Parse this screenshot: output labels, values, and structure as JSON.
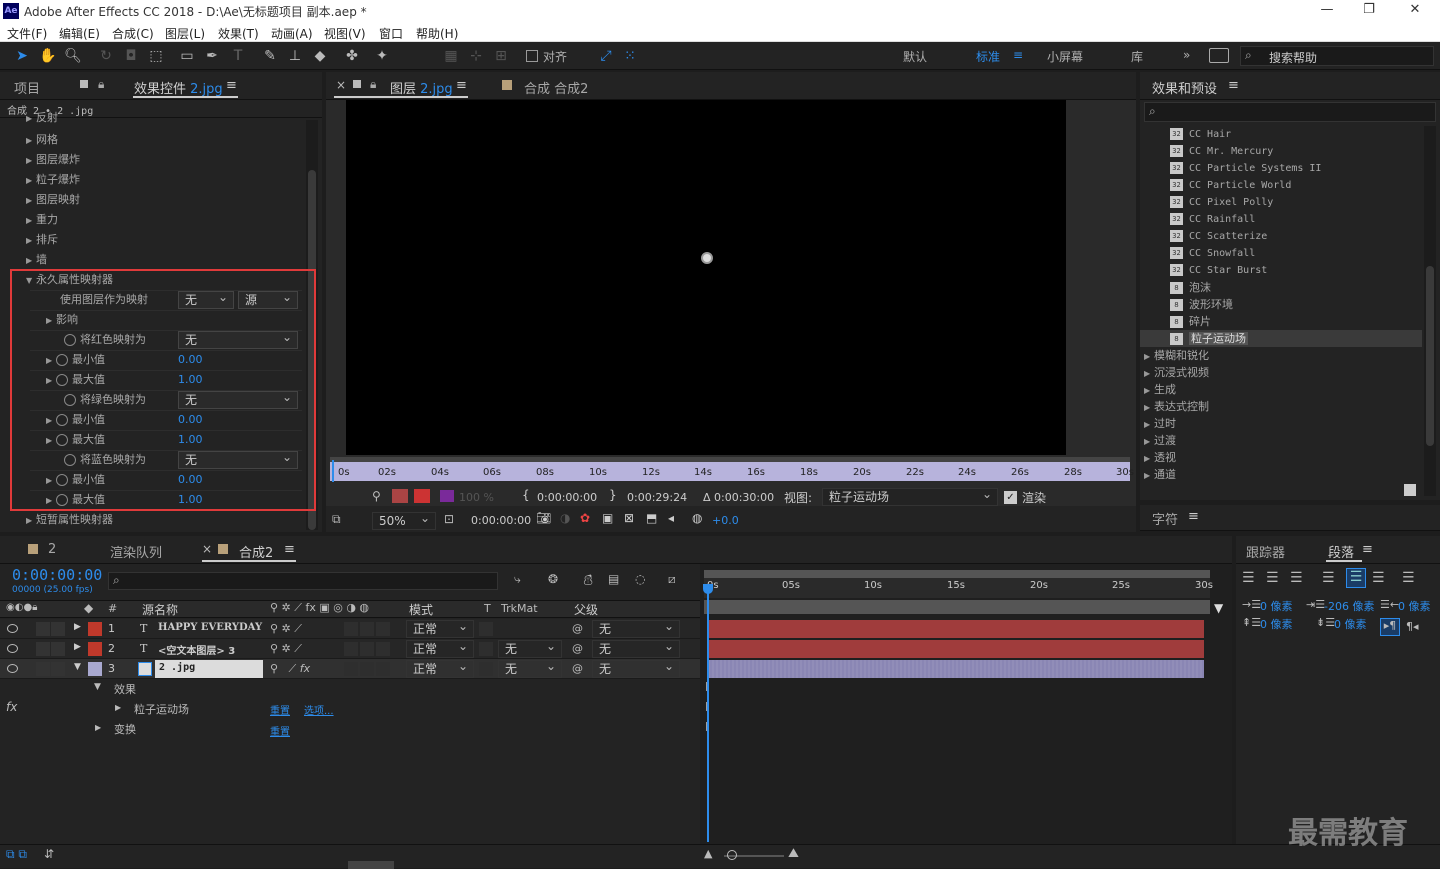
{
  "titlebar": {
    "title": "Adobe After Effects CC 2018 - D:\\Ae\\无标题项目 副本.aep *",
    "logo": "Ae",
    "minimize": "—",
    "maximize": "❐",
    "close": "✕"
  },
  "menu": [
    "文件(F)",
    "编辑(E)",
    "合成(C)",
    "图层(L)",
    "效果(T)",
    "动画(A)",
    "视图(V)",
    "窗口",
    "帮助(H)"
  ],
  "toolbar": {
    "snap_label": "对齐",
    "workspaces": [
      "默认",
      "标准",
      "小屏幕",
      "库"
    ],
    "active_workspace": "标准",
    "search_placeholder": "搜索帮助"
  },
  "left_panel": {
    "tabs": [
      "项目",
      "效果控件"
    ],
    "active_file": "2.jpg",
    "breadcrumb": "合成 2 • 2 .jpg",
    "top_items": [
      "反射",
      "网格",
      "图层爆炸",
      "粒子爆炸",
      "图层映射",
      "重力",
      "排斥",
      "墙"
    ],
    "section_title": "永久属性映射器",
    "use_layer_label": "使用图层作为映射",
    "use_layer_value": "无",
    "use_layer_source": "源",
    "influence_label": "影响",
    "map_red_label": "将红色映射为",
    "map_red_value": "无",
    "min_label": "最小值",
    "max_label": "最大值",
    "min_value": "0.00",
    "max_value": "1.00",
    "map_green_label": "将绿色映射为",
    "map_green_value": "无",
    "map_blue_label": "将蓝色映射为",
    "map_blue_value": "无",
    "transient_label": "短暂属性映射器"
  },
  "viewer": {
    "tabs": [
      "图层",
      "合成 合成2"
    ],
    "layer_file": "2.jpg",
    "ruler": [
      "0s",
      "02s",
      "04s",
      "06s",
      "08s",
      "10s",
      "12s",
      "14s",
      "16s",
      "18s",
      "20s",
      "22s",
      "24s",
      "26s",
      "28s",
      "30s"
    ],
    "opacity": "100 %",
    "in_time": "0:00:00:00",
    "out_time": "0:00:29:24",
    "duration": "Δ 0:00:30:00",
    "view_label": "视图:",
    "view_value": "粒子运动场",
    "render_label": "渲染",
    "zoom": "50%",
    "current_time": "0:00:00:00",
    "exposure": "+0.0"
  },
  "effects_panel": {
    "title": "效果和预设",
    "items": [
      "CC Hair",
      "CC Mr. Mercury",
      "CC Particle Systems II",
      "CC Particle World",
      "CC Pixel Polly",
      "CC Rainfall",
      "CC Scatterize",
      "CC Snowfall",
      "CC Star Burst",
      "泡沫",
      "波形环境",
      "碎片",
      "粒子运动场"
    ],
    "selected": "粒子运动场",
    "categories": [
      "模糊和锐化",
      "沉浸式视频",
      "生成",
      "表达式控制",
      "过时",
      "过渡",
      "透视",
      "通道"
    ],
    "char_panel": "字符"
  },
  "timeline": {
    "tabs": [
      "2",
      "渲染队列",
      "合成2"
    ],
    "timecode": "0:00:00:00",
    "fps": "00000 (25.00 fps)",
    "columns": {
      "num": "#",
      "source": "源名称",
      "mode": "模式",
      "t": "T",
      "trkmat": "TrkMat",
      "parent": "父级"
    },
    "layers": [
      {
        "num": "1",
        "type": "T",
        "name": "HAPPY EVERYDAY",
        "mode": "正常",
        "trkmat": "",
        "parent": "无",
        "color": "#c0392b"
      },
      {
        "num": "2",
        "type": "T",
        "name": "<空文本图层> 3",
        "mode": "正常",
        "trkmat": "无",
        "parent": "无",
        "color": "#c0392b"
      },
      {
        "num": "3",
        "type": "img",
        "name": "2 .jpg",
        "mode": "正常",
        "trkmat": "无",
        "parent": "无",
        "color": "#a9a9d0"
      }
    ],
    "effects_label": "效果",
    "particle_label": "粒子运动场",
    "reset_label": "重置",
    "options_label": "选项...",
    "transform_label": "变换",
    "ruler": [
      "0s",
      "05s",
      "10s",
      "15s",
      "20s",
      "25s",
      "30s"
    ]
  },
  "right_bottom": {
    "tabs": [
      "跟踪器",
      "段落"
    ],
    "indent_left": "0 像素",
    "indent_first": "-206 像素",
    "indent_right": "0 像素",
    "space_before": "0 像素",
    "space_after": "0 像素"
  },
  "watermark": "最需教育"
}
